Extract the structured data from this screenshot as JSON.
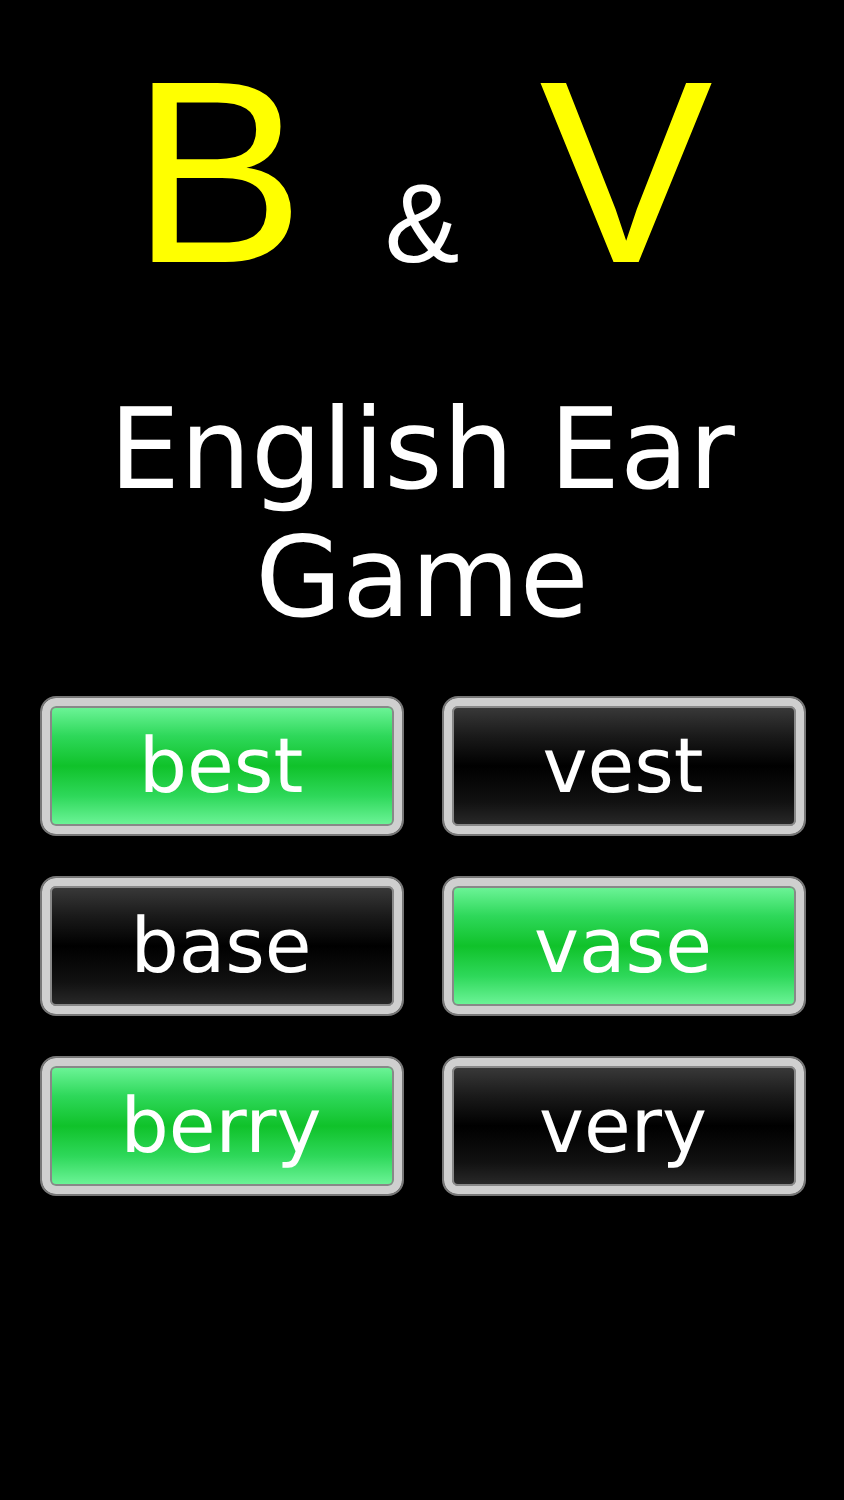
{
  "logo": [
    {
      "text": "B",
      "kind": "letter"
    },
    {
      "text": "&",
      "kind": "joiner"
    },
    {
      "text": "V",
      "kind": "letter"
    }
  ],
  "title": "English Ear Game",
  "words": [
    {
      "label": "best",
      "selected": true
    },
    {
      "label": "vest",
      "selected": false
    },
    {
      "label": "base",
      "selected": false
    },
    {
      "label": "vase",
      "selected": true
    },
    {
      "label": "berry",
      "selected": true
    },
    {
      "label": "very",
      "selected": false
    }
  ]
}
